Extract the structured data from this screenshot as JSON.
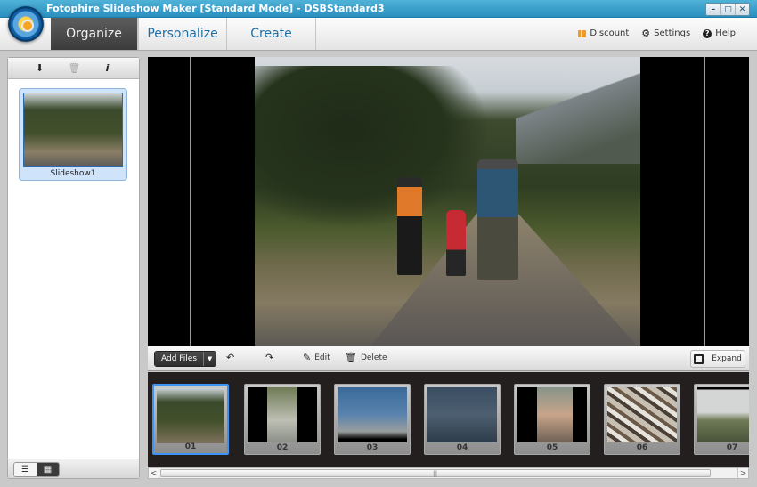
{
  "window": {
    "title": "Fotophire Slideshow Maker [Standard Mode] - DSBStandard3",
    "controls": {
      "minimize": "–",
      "maximize": "□",
      "close": "✕"
    }
  },
  "nav": {
    "tabs": [
      {
        "label": "Organize",
        "active": true
      },
      {
        "label": "Personalize",
        "active": false
      },
      {
        "label": "Create",
        "active": false
      }
    ],
    "links": [
      {
        "label": "Discount",
        "icon": "gift-icon"
      },
      {
        "label": "Settings",
        "icon": "gear-icon"
      },
      {
        "label": "Help",
        "icon": "help-icon"
      }
    ],
    "help_glyph": "?",
    "gear_glyph": "⚙"
  },
  "left_panel": {
    "toolbar_icons": {
      "import": "⬇",
      "delete": "🗑",
      "info": "i"
    },
    "slideshows": [
      {
        "label": "Slideshow1",
        "selected": true
      }
    ],
    "view_toggle": {
      "list": "☰",
      "grid": "▦",
      "active": "grid"
    }
  },
  "action_bar": {
    "add_files": "Add Files",
    "dropdown_glyph": "▼",
    "rotate_left_glyph": "↶",
    "rotate_right_glyph": "↷",
    "edit": "Edit",
    "edit_glyph": "✎",
    "delete": "Delete",
    "delete_glyph": "♲",
    "expand": "Expand"
  },
  "filmstrip": {
    "slides": [
      {
        "number": "01",
        "selected": true
      },
      {
        "number": "02",
        "selected": false
      },
      {
        "number": "03",
        "selected": false
      },
      {
        "number": "04",
        "selected": false
      },
      {
        "number": "05",
        "selected": false
      },
      {
        "number": "06",
        "selected": false
      },
      {
        "number": "07",
        "selected": false
      }
    ]
  },
  "scrollbar": {
    "left": "<",
    "right": ">",
    "grip": "|||"
  },
  "colors": {
    "title_bar": "#2a8fbf",
    "active_tab": "#3b3b3b",
    "tab_text": "#1f6fa6",
    "selection": "#3b93f5",
    "discount": "#f39a24"
  }
}
